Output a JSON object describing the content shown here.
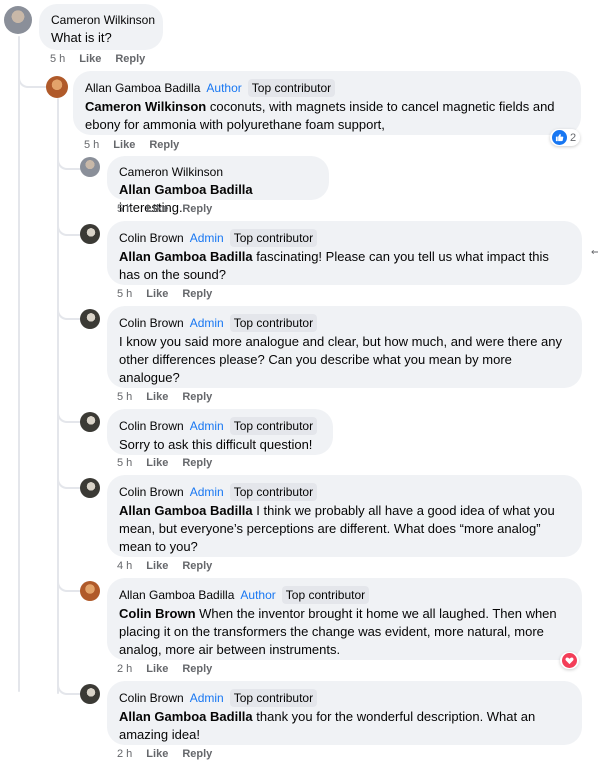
{
  "labels": {
    "like": "Like",
    "reply": "Reply"
  },
  "comments": [
    {
      "author": "Cameron Wilkinson",
      "role": "",
      "badge": "",
      "mention": "",
      "text": "What is it?",
      "time": "5 h"
    },
    {
      "author": "Allan Gamboa Badilla",
      "role": "Author",
      "badge": "Top contributor",
      "mention": "Cameron Wilkinson",
      "text": " coconuts, with magnets inside to cancel magnetic fields and ebony for ammonia with polyurethane foam support,",
      "time": "5 h",
      "reaction_count": "2"
    },
    {
      "author": "Cameron Wilkinson",
      "role": "",
      "badge": "",
      "mention": "Allan Gamboa Badilla",
      "text": " interesting.",
      "time": "5 h"
    },
    {
      "author": "Colin Brown",
      "role": "Admin",
      "badge": "Top contributor",
      "mention": "Allan Gamboa Badilla",
      "text": " fascinating! Please can you tell us what impact this has on the sound?",
      "time": "5 h"
    },
    {
      "author": "Colin Brown",
      "role": "Admin",
      "badge": "Top contributor",
      "mention": "",
      "text": "I know you said more analogue and clear, but how much, and were there any other differences please? Can you describe what you mean by more analogue?",
      "time": "5 h"
    },
    {
      "author": "Colin Brown",
      "role": "Admin",
      "badge": "Top contributor",
      "mention": "",
      "text": "Sorry to ask this difficult question!",
      "time": "5 h"
    },
    {
      "author": "Colin Brown",
      "role": "Admin",
      "badge": "Top contributor",
      "mention": "Allan Gamboa Badilla",
      "text": " I think we probably all have a good idea of what you mean, but everyone’s perceptions are different. What does “more analog” mean to you?",
      "time": "4 h"
    },
    {
      "author": "Allan Gamboa Badilla",
      "role": "Author",
      "badge": "Top contributor",
      "mention": "Colin Brown",
      "text": " When the inventor brought it home we all laughed. Then when placing it on the transformers the change was evident, more natural, more analog, more air between instruments.",
      "time": "2 h"
    },
    {
      "author": "Colin Brown",
      "role": "Admin",
      "badge": "Top contributor",
      "mention": "Allan Gamboa Badilla",
      "text": " thank you for the wonderful description. What an amazing idea!",
      "time": "2 h"
    }
  ],
  "icons": {
    "like_reaction": "thumbs-up-icon",
    "love_reaction": "heart-icon"
  },
  "colors": {
    "role": "#1877f2",
    "bubble": "#f0f2f5",
    "like": "#1877f2",
    "love": "#f33e58"
  }
}
